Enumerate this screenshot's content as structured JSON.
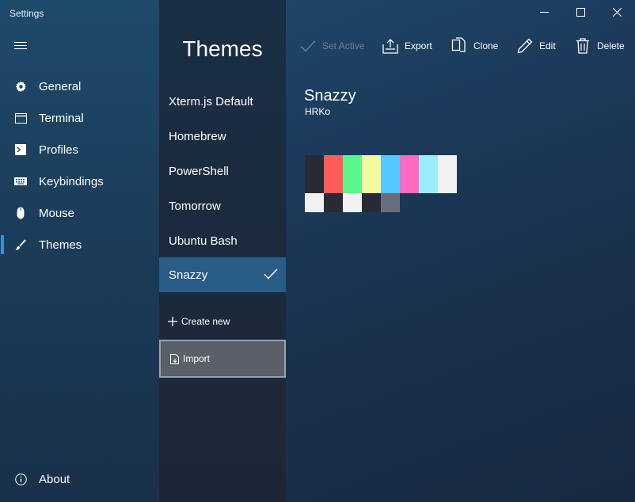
{
  "window": {
    "title": "Settings"
  },
  "nav": {
    "items": [
      {
        "label": "General",
        "icon": "gear-icon"
      },
      {
        "label": "Terminal",
        "icon": "window-icon"
      },
      {
        "label": "Profiles",
        "icon": "terminal-prompt-icon"
      },
      {
        "label": "Keybindings",
        "icon": "keyboard-icon"
      },
      {
        "label": "Mouse",
        "icon": "mouse-icon"
      },
      {
        "label": "Themes",
        "icon": "paintbrush-icon",
        "active": true
      }
    ],
    "about": {
      "label": "About",
      "icon": "info-icon"
    }
  },
  "themes": {
    "heading": "Themes",
    "list": [
      {
        "label": "Xterm.js Default"
      },
      {
        "label": "Homebrew"
      },
      {
        "label": "PowerShell"
      },
      {
        "label": "Tomorrow"
      },
      {
        "label": "Ubuntu Bash"
      },
      {
        "label": "Snazzy",
        "selected": true
      }
    ],
    "create_new": "Create new",
    "import": "Import"
  },
  "toolbar": {
    "set_active": "Set Active",
    "export": "Export",
    "clone": "Clone",
    "edit": "Edit",
    "delete": "Delete"
  },
  "detail": {
    "name": "Snazzy",
    "author": "HRKo",
    "palette_top": [
      "#282a36",
      "#ff5c57",
      "#5af78e",
      "#f3f99d",
      "#57c7ff",
      "#ff6ac1",
      "#9aedfe",
      "#f1f1f0"
    ],
    "palette_bottom": [
      "#f1f1f0",
      "#282a36",
      "#f1f1f0",
      "#282a36",
      "#686e7e"
    ]
  },
  "colors": {
    "accent": "#3a8fd8",
    "selected_item": "#2a5c88"
  }
}
